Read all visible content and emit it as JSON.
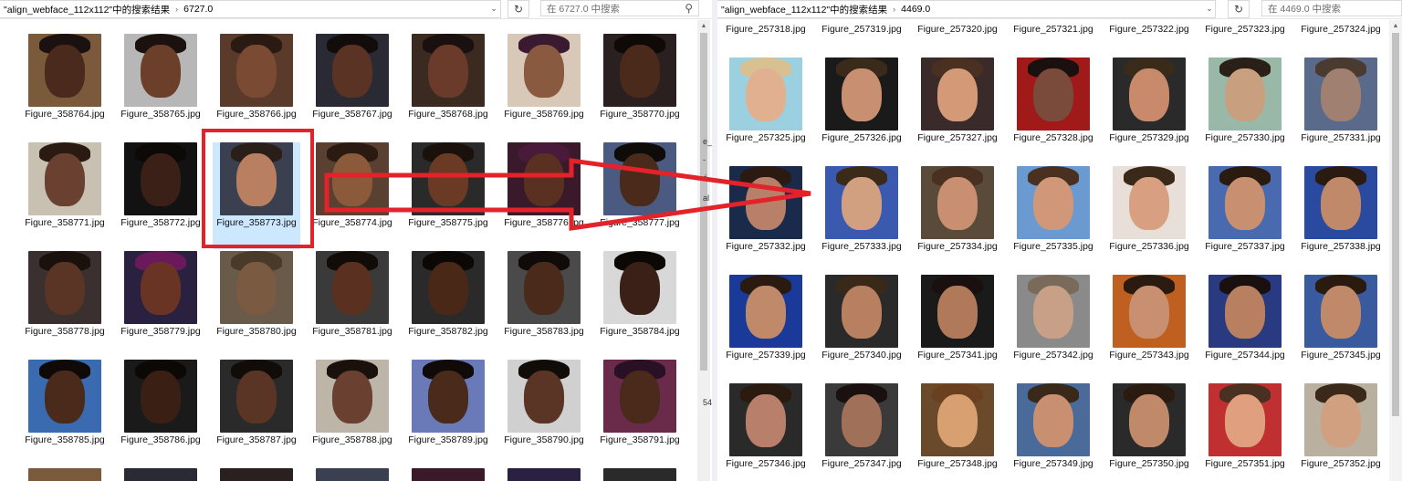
{
  "left": {
    "breadcrumb": [
      "\"align_webface_112x112\"中的搜索结果",
      "6727.0"
    ],
    "search_placeholder": "在 6727.0 中搜索",
    "items": [
      {
        "name": "Figure_358764.jpg",
        "skin": "#4a2a1c",
        "hair": "#1a1110",
        "bg": "#7a5a3a"
      },
      {
        "name": "Figure_358765.jpg",
        "skin": "#6b3f2a",
        "hair": "#1b1210",
        "bg": "#b7b7b7"
      },
      {
        "name": "Figure_358766.jpg",
        "skin": "#7a4a33",
        "hair": "#2a1a12",
        "bg": "#5a3a2a"
      },
      {
        "name": "Figure_358767.jpg",
        "skin": "#5a3324",
        "hair": "#120c0a",
        "bg": "#2a2a34"
      },
      {
        "name": "Figure_358768.jpg",
        "skin": "#6a3a2a",
        "hair": "#1a1010",
        "bg": "#3a2a20"
      },
      {
        "name": "Figure_358769.jpg",
        "skin": "#8a5a40",
        "hair": "#3a1a30",
        "bg": "#d8c8b8"
      },
      {
        "name": "Figure_358770.jpg",
        "skin": "#4a2a1a",
        "hair": "#0f0a08",
        "bg": "#2a2020"
      },
      {
        "name": "Figure_358771.jpg",
        "skin": "#6a4030",
        "hair": "#2a1a12",
        "bg": "#c8c0b0"
      },
      {
        "name": "Figure_358772.jpg",
        "skin": "#3a2016",
        "hair": "#0d0906",
        "bg": "#121212"
      },
      {
        "name": "Figure_358773.jpg",
        "skin": "#b88060",
        "hair": "#2a1f18",
        "bg": "#3a4050"
      },
      {
        "name": "Figure_358774.jpg",
        "skin": "#8a5a3a",
        "hair": "#2a1a12",
        "bg": "#5a4030"
      },
      {
        "name": "Figure_358775.jpg",
        "skin": "#6a3a24",
        "hair": "#1a100c",
        "bg": "#2a2a2a"
      },
      {
        "name": "Figure_358776.jpg",
        "skin": "#5a3020",
        "hair": "#4a1a3a",
        "bg": "#3a1a2a"
      },
      {
        "name": "Figure_358777.jpg",
        "skin": "#4a2a1a",
        "hair": "#0f0b08",
        "bg": "#4a5a80"
      },
      {
        "name": "Figure_358778.jpg",
        "skin": "#5a3424",
        "hair": "#1a100c",
        "bg": "#3a3030"
      },
      {
        "name": "Figure_358779.jpg",
        "skin": "#6a3424",
        "hair": "#6a1a5a",
        "bg": "#2a2040"
      },
      {
        "name": "Figure_358780.jpg",
        "skin": "#7a5a40",
        "hair": "#4a3a2a",
        "bg": "#6a5a4a"
      },
      {
        "name": "Figure_358781.jpg",
        "skin": "#5a3020",
        "hair": "#120c08",
        "bg": "#3a3a3a"
      },
      {
        "name": "Figure_358782.jpg",
        "skin": "#4a2818",
        "hair": "#0c0806",
        "bg": "#2a2a2a"
      },
      {
        "name": "Figure_358783.jpg",
        "skin": "#4a2a1a",
        "hair": "#100a08",
        "bg": "#4a4a4a"
      },
      {
        "name": "Figure_358784.jpg",
        "skin": "#3a2016",
        "hair": "#0c0806",
        "bg": "#d8d8d8"
      },
      {
        "name": "Figure_358785.jpg",
        "skin": "#4a2a1a",
        "hair": "#0f0a08",
        "bg": "#3a6ab0"
      },
      {
        "name": "Figure_358786.jpg",
        "skin": "#3a2014",
        "hair": "#0c0806",
        "bg": "#1a1a1a"
      },
      {
        "name": "Figure_358787.jpg",
        "skin": "#5a3424",
        "hair": "#120c08",
        "bg": "#2a2a2a"
      },
      {
        "name": "Figure_358788.jpg",
        "skin": "#6a4030",
        "hair": "#1a100c",
        "bg": "#bdb5a8"
      },
      {
        "name": "Figure_358789.jpg",
        "skin": "#4a2a1a",
        "hair": "#100a08",
        "bg": "#6a7ab8"
      },
      {
        "name": "Figure_358790.jpg",
        "skin": "#5a3424",
        "hair": "#120c08",
        "bg": "#d0d0d0"
      },
      {
        "name": "Figure_358791.jpg",
        "skin": "#4a2a1a",
        "hair": "#2a1024",
        "bg": "#6a2a4a"
      }
    ],
    "selected_index": 9
  },
  "right": {
    "breadcrumb": [
      "\"align_webface_112x112\"中的搜索结果",
      "4469.0"
    ],
    "search_placeholder": "在 4469.0 中搜索",
    "top_labels": [
      "Figure_257318.jpg",
      "Figure_257319.jpg",
      "Figure_257320.jpg",
      "Figure_257321.jpg",
      "Figure_257322.jpg",
      "Figure_257323.jpg",
      "Figure_257324.jpg"
    ],
    "items": [
      {
        "name": "Figure_257325.jpg",
        "skin": "#e0b090",
        "hair": "#d8c090",
        "bg": "#9ad0e0"
      },
      {
        "name": "Figure_257326.jpg",
        "skin": "#c89070",
        "hair": "#3a2a1a",
        "bg": "#1a1a1a"
      },
      {
        "name": "Figure_257327.jpg",
        "skin": "#d49a78",
        "hair": "#4a3020",
        "bg": "#3a2a2a"
      },
      {
        "name": "Figure_257328.jpg",
        "skin": "#7a4a3a",
        "hair": "#1a1010",
        "bg": "#a01a1a"
      },
      {
        "name": "Figure_257329.jpg",
        "skin": "#c88a6a",
        "hair": "#3a2a1a",
        "bg": "#2a2a2a"
      },
      {
        "name": "Figure_257330.jpg",
        "skin": "#c8a080",
        "hair": "#2a2018",
        "bg": "#9ab8a8"
      },
      {
        "name": "Figure_257331.jpg",
        "skin": "#a08070",
        "hair": "#4a3a30",
        "bg": "#5a6a8a"
      },
      {
        "name": "Figure_257332.jpg",
        "skin": "#b88068",
        "hair": "#2a1a12",
        "bg": "#1a2a4a"
      },
      {
        "name": "Figure_257333.jpg",
        "skin": "#d0a080",
        "hair": "#3a2a1a",
        "bg": "#3a5ab0"
      },
      {
        "name": "Figure_257334.jpg",
        "skin": "#c89070",
        "hair": "#4a3020",
        "bg": "#5a4a3a"
      },
      {
        "name": "Figure_257335.jpg",
        "skin": "#d09878",
        "hair": "#4a3020",
        "bg": "#6a9ad0"
      },
      {
        "name": "Figure_257336.jpg",
        "skin": "#d8a080",
        "hair": "#3a2818",
        "bg": "#e8e0d8"
      },
      {
        "name": "Figure_257337.jpg",
        "skin": "#c89070",
        "hair": "#2a1a10",
        "bg": "#4a6ab0"
      },
      {
        "name": "Figure_257338.jpg",
        "skin": "#c08a6a",
        "hair": "#2a1a10",
        "bg": "#2a4aa0"
      },
      {
        "name": "Figure_257339.jpg",
        "skin": "#c08a6a",
        "hair": "#2a1a10",
        "bg": "#1a3a9a"
      },
      {
        "name": "Figure_257340.jpg",
        "skin": "#b88060",
        "hair": "#3a2818",
        "bg": "#2a2a2a"
      },
      {
        "name": "Figure_257341.jpg",
        "skin": "#b07a5a",
        "hair": "#1a1010",
        "bg": "#1a1a1a"
      },
      {
        "name": "Figure_257342.jpg",
        "skin": "#c8a088",
        "hair": "#7a6a5a",
        "bg": "#8a8a8a"
      },
      {
        "name": "Figure_257343.jpg",
        "skin": "#c89070",
        "hair": "#2a1a10",
        "bg": "#c06020"
      },
      {
        "name": "Figure_257344.jpg",
        "skin": "#b88060",
        "hair": "#1a1010",
        "bg": "#2a3a80"
      },
      {
        "name": "Figure_257345.jpg",
        "skin": "#c08a6a",
        "hair": "#2a1a10",
        "bg": "#3a5aa0"
      },
      {
        "name": "Figure_257346.jpg",
        "skin": "#b8806a",
        "hair": "#2a1a10",
        "bg": "#2a2a2a"
      },
      {
        "name": "Figure_257347.jpg",
        "skin": "#a07058",
        "hair": "#1a1010",
        "bg": "#3a3a3a"
      },
      {
        "name": "Figure_257348.jpg",
        "skin": "#d8a070",
        "hair": "#6a4020",
        "bg": "#6a4a2a"
      },
      {
        "name": "Figure_257349.jpg",
        "skin": "#c89070",
        "hair": "#3a2818",
        "bg": "#4a6a9a"
      },
      {
        "name": "Figure_257350.jpg",
        "skin": "#c08a6a",
        "hair": "#2a1a10",
        "bg": "#2a2a2a"
      },
      {
        "name": "Figure_257351.jpg",
        "skin": "#e0a080",
        "hair": "#4a3020",
        "bg": "#c03030"
      },
      {
        "name": "Figure_257352.jpg",
        "skin": "#d0a080",
        "hair": "#3a2818",
        "bg": "#bab0a0"
      }
    ]
  },
  "edge_glyphs": [
    "e_",
    "-",
    "é",
    "al",
    "54"
  ],
  "colors": {
    "annotation_red": "#e3222a",
    "selection_blue": "#cce8ff"
  }
}
